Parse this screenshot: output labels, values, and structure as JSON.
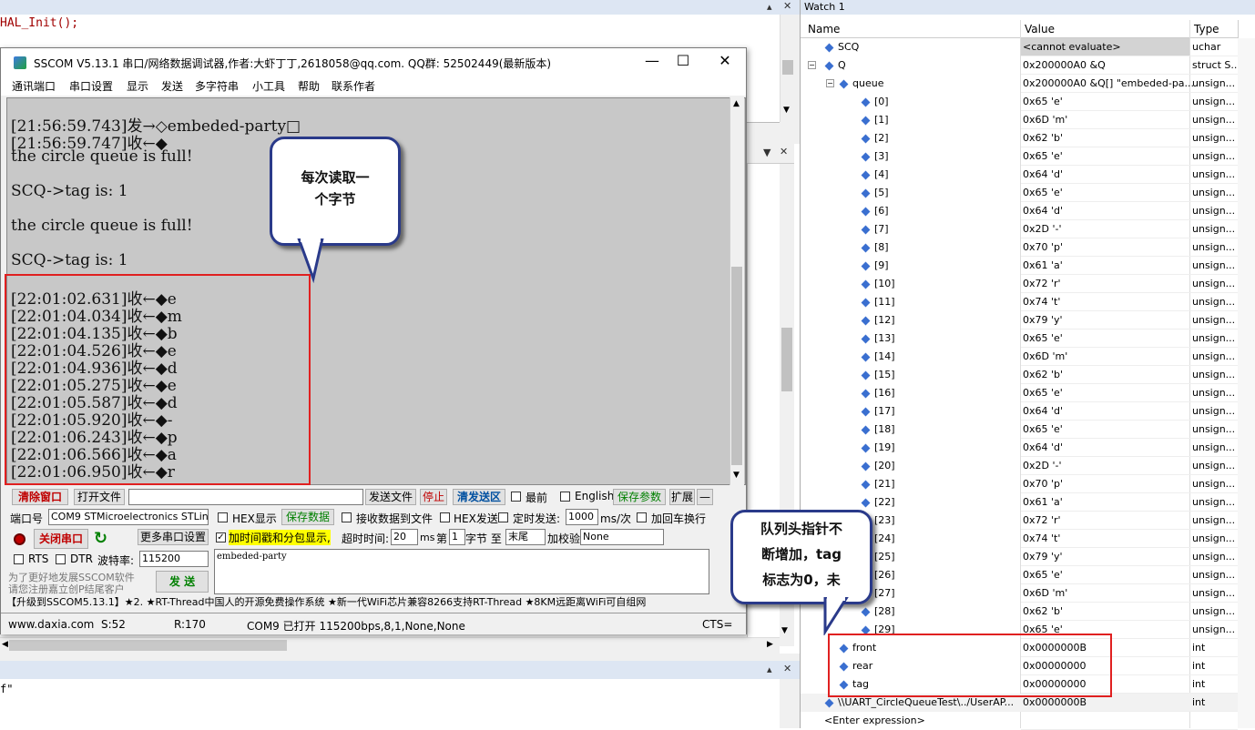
{
  "editor": {
    "code_line": "HAL_Init();",
    "bottom_text": "f\""
  },
  "sscom": {
    "title": "SSCOM V5.13.1 串口/网络数据调试器,作者:大虾丁丁,2618058@qq.com. QQ群: 52502449(最新版本)",
    "menu": [
      "通讯端口",
      "串口设置",
      "显示",
      "发送",
      "多字符串",
      "小工具",
      "帮助",
      "联系作者"
    ],
    "output_lines": [
      "[21:56:59.743]发→◇embeded-party□",
      "[21:56:59.747]收←◆",
      "the circle queue is full!",
      "",
      "SCQ->tag is: 1",
      "",
      "the circle queue is full!",
      "",
      "SCQ->tag is: 1",
      "",
      "[22:01:02.631]收←◆e",
      "[22:01:04.034]收←◆m",
      "[22:01:04.135]收←◆b",
      "[22:01:04.526]收←◆e",
      "[22:01:04.936]收←◆d",
      "[22:01:05.275]收←◆e",
      "[22:01:05.587]收←◆d",
      "[22:01:05.920]收←◆-",
      "[22:01:06.243]收←◆p",
      "[22:01:06.566]收←◆a",
      "[22:01:06.950]收←◆r"
    ],
    "controls": {
      "clear_window": "清除窗口",
      "open_file": "打开文件",
      "send_file": "发送文件",
      "stop": "停止",
      "clear_send": "清发送区",
      "topmost": "最前",
      "english": "English",
      "save_params": "保存参数",
      "expand": "扩展",
      "collapse": "—",
      "port_label": "端口号",
      "port_value": "COM9 STMicroelectronics STLink",
      "hex_display": "HEX显示",
      "save_data": "保存数据",
      "recv_to_file": "接收数据到文件",
      "hex_send": "HEX发送",
      "timed_send": "定时发送:",
      "interval_value": "1000",
      "interval_unit": "ms/次",
      "add_crlf": "加回车换行",
      "close_port": "关闭串口",
      "more_settings": "更多串口设置",
      "timestamp": "加时间戳和分包显示,",
      "timeout_label": "超时时间:",
      "timeout_value": "20",
      "ms": "ms",
      "byte_from": "第",
      "byte_index": "1",
      "byte_to": "字节 至",
      "tail": "末尾",
      "checksum": "加校验",
      "checksum_value": "None",
      "rts": "RTS",
      "dtr": "DTR",
      "baud_label": "波特率:",
      "baud_value": "115200",
      "send_text": "embeded-party",
      "promo": "为了更好地发展SSCOM软件\n请您注册嘉立创P结尾客户",
      "send": "发 送"
    },
    "ad_line": "【升级到SSCOM5.13.1】★2. ★RT-Thread中国人的开源免费操作系统 ★新一代WiFi芯片兼容8266支持RT-Thread ★8KM远距离WiFi可自组网",
    "status": {
      "url": "www.daxia.com",
      "sent": "S:52",
      "recv": "R:170",
      "port_info": "COM9 已打开  115200bps,8,1,None,None",
      "cts": "CTS="
    }
  },
  "callouts": {
    "read_byte": "每次读取一\n个字节",
    "head_pointer": "队列头指针不\n断增加，tag\n标志为0，未"
  },
  "watch": {
    "title": "Watch 1",
    "headers": {
      "name": "Name",
      "value": "Value",
      "type": "Type"
    },
    "rows": [
      {
        "name": "SCQ",
        "value": "<cannot evaluate>",
        "type": "uchar",
        "indent": 0
      },
      {
        "name": "Q",
        "value": "0x200000A0 &Q",
        "type": "struct S...",
        "indent": 0
      },
      {
        "name": "queue",
        "value": "0x200000A0 &Q[] \"embeded-pa...",
        "type": "unsign...",
        "indent": 1
      },
      {
        "name": "[0]",
        "value": "0x65 'e'",
        "type": "unsign...",
        "indent": 2
      },
      {
        "name": "[1]",
        "value": "0x6D 'm'",
        "type": "unsign...",
        "indent": 2
      },
      {
        "name": "[2]",
        "value": "0x62 'b'",
        "type": "unsign...",
        "indent": 2
      },
      {
        "name": "[3]",
        "value": "0x65 'e'",
        "type": "unsign...",
        "indent": 2
      },
      {
        "name": "[4]",
        "value": "0x64 'd'",
        "type": "unsign...",
        "indent": 2
      },
      {
        "name": "[5]",
        "value": "0x65 'e'",
        "type": "unsign...",
        "indent": 2
      },
      {
        "name": "[6]",
        "value": "0x64 'd'",
        "type": "unsign...",
        "indent": 2
      },
      {
        "name": "[7]",
        "value": "0x2D '-'",
        "type": "unsign...",
        "indent": 2
      },
      {
        "name": "[8]",
        "value": "0x70 'p'",
        "type": "unsign...",
        "indent": 2
      },
      {
        "name": "[9]",
        "value": "0x61 'a'",
        "type": "unsign...",
        "indent": 2
      },
      {
        "name": "[10]",
        "value": "0x72 'r'",
        "type": "unsign...",
        "indent": 2
      },
      {
        "name": "[11]",
        "value": "0x74 't'",
        "type": "unsign...",
        "indent": 2
      },
      {
        "name": "[12]",
        "value": "0x79 'y'",
        "type": "unsign...",
        "indent": 2
      },
      {
        "name": "[13]",
        "value": "0x65 'e'",
        "type": "unsign...",
        "indent": 2
      },
      {
        "name": "[14]",
        "value": "0x6D 'm'",
        "type": "unsign...",
        "indent": 2
      },
      {
        "name": "[15]",
        "value": "0x62 'b'",
        "type": "unsign...",
        "indent": 2
      },
      {
        "name": "[16]",
        "value": "0x65 'e'",
        "type": "unsign...",
        "indent": 2
      },
      {
        "name": "[17]",
        "value": "0x64 'd'",
        "type": "unsign...",
        "indent": 2
      },
      {
        "name": "[18]",
        "value": "0x65 'e'",
        "type": "unsign...",
        "indent": 2
      },
      {
        "name": "[19]",
        "value": "0x64 'd'",
        "type": "unsign...",
        "indent": 2
      },
      {
        "name": "[20]",
        "value": "0x2D '-'",
        "type": "unsign...",
        "indent": 2
      },
      {
        "name": "[21]",
        "value": "0x70 'p'",
        "type": "unsign...",
        "indent": 2
      },
      {
        "name": "[22]",
        "value": "0x61 'a'",
        "type": "unsign...",
        "indent": 2
      },
      {
        "name": "[23]",
        "value": "0x72 'r'",
        "type": "unsign...",
        "indent": 2
      },
      {
        "name": "[24]",
        "value": "0x74 't'",
        "type": "unsign...",
        "indent": 2
      },
      {
        "name": "[25]",
        "value": "0x79 'y'",
        "type": "unsign...",
        "indent": 2
      },
      {
        "name": "[26]",
        "value": "0x65 'e'",
        "type": "unsign...",
        "indent": 2
      },
      {
        "name": "[27]",
        "value": "0x6D 'm'",
        "type": "unsign...",
        "indent": 2
      },
      {
        "name": "[28]",
        "value": "0x62 'b'",
        "type": "unsign...",
        "indent": 2
      },
      {
        "name": "[29]",
        "value": "0x65 'e'",
        "type": "unsign...",
        "indent": 2
      },
      {
        "name": "front",
        "value": "0x0000000B",
        "type": "int",
        "indent": 1
      },
      {
        "name": "rear",
        "value": "0x00000000",
        "type": "int",
        "indent": 1
      },
      {
        "name": "tag",
        "value": "0x00000000",
        "type": "int",
        "indent": 1
      },
      {
        "name": "\\\\UART_CircleQueueTest\\../UserAP...",
        "value": "0x0000000B",
        "type": "int",
        "indent": 0
      },
      {
        "name": "<Enter expression>",
        "value": "",
        "type": "",
        "indent": 0
      }
    ]
  },
  "colors": {
    "accent": "#2a3a8a",
    "highlight": "#e02020",
    "output_bg": "#c8c8c8"
  }
}
